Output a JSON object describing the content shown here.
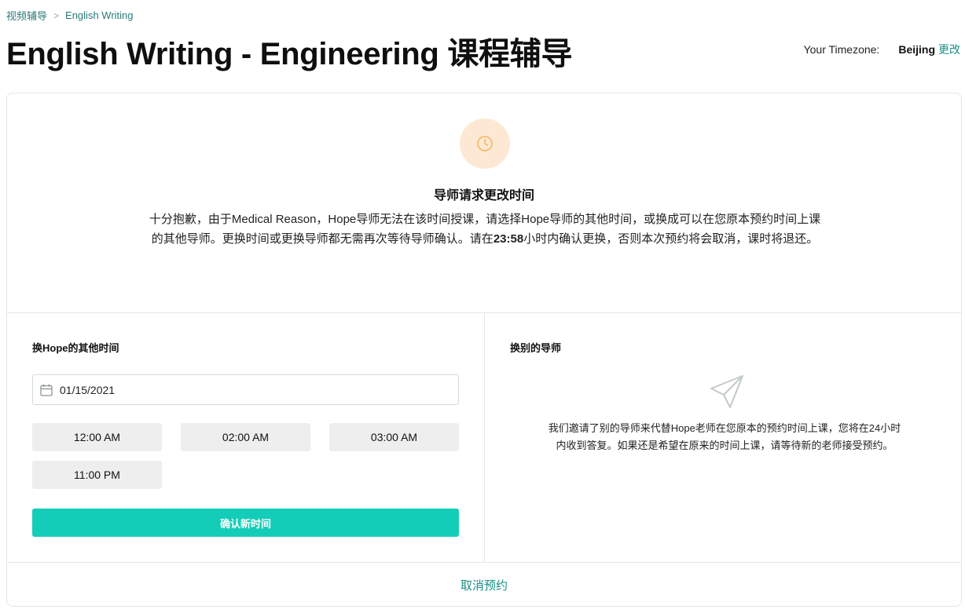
{
  "breadcrumb": {
    "items": [
      "视频辅导",
      "English Writing"
    ],
    "separator": ">"
  },
  "page": {
    "title": "English Writing - Engineering 课程辅导"
  },
  "timezone": {
    "label": "Your Timezone:",
    "value": "Beijing",
    "change_label": "更改"
  },
  "notice": {
    "icon": "clock-icon",
    "title": "导师请求更改时间",
    "body_part1": "十分抱歉，由于Medical Reason，Hope导师无法在该时间授课，请选择Hope导师的其他时间，或换成可以在您原本预约时间上课的其他导师。更换时间或更换导师都无需再次等待导师确认。请在",
    "deadline": "23:58",
    "body_part2": "小时内确认更换，否则本次预约将会取消，课时将退还。"
  },
  "reschedule": {
    "title": "换Hope的其他时间",
    "date_value": "01/15/2021",
    "calendar_icon": "calendar-icon",
    "slots": [
      "12:00 AM",
      "02:00 AM",
      "03:00 AM",
      "11:00 PM"
    ],
    "confirm_label": "确认新时间"
  },
  "other_tutor": {
    "title": "换别的导师",
    "icon": "send-icon",
    "body": "我们邀请了别的导师来代替Hope老师在您原本的预约时间上课，您将在24小时内收到答复。如果还是希望在原来的时间上课，请等待新的老师接受预约。"
  },
  "footer": {
    "cancel_label": "取消预约"
  },
  "colors": {
    "accent": "#14cdb8",
    "link": "#1a8f84",
    "clock_bg": "#fde9d3",
    "clock_stroke": "#f5b971"
  }
}
